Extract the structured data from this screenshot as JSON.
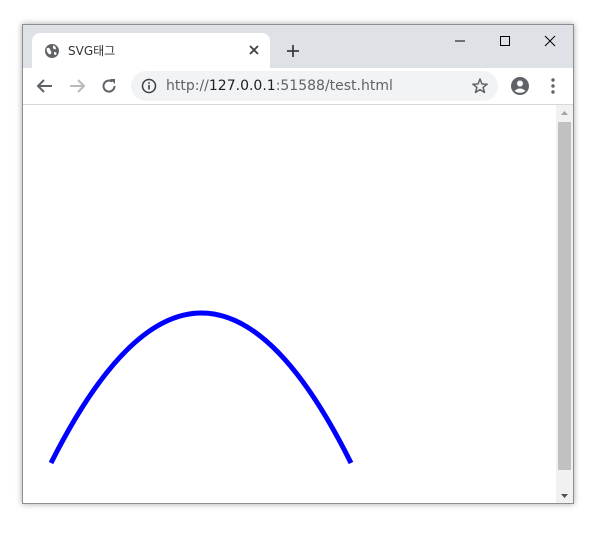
{
  "tab": {
    "title": "SVG태그",
    "favicon": "globe-icon"
  },
  "toolbar": {
    "url_prefix": "http://",
    "url_host": "127.0.0.1",
    "url_rest": ":51588/test.html"
  },
  "colors": {
    "curve_stroke": "#0000ff",
    "titlebar_bg": "#dee1e6",
    "omnibox_bg": "#f1f3f4"
  }
}
